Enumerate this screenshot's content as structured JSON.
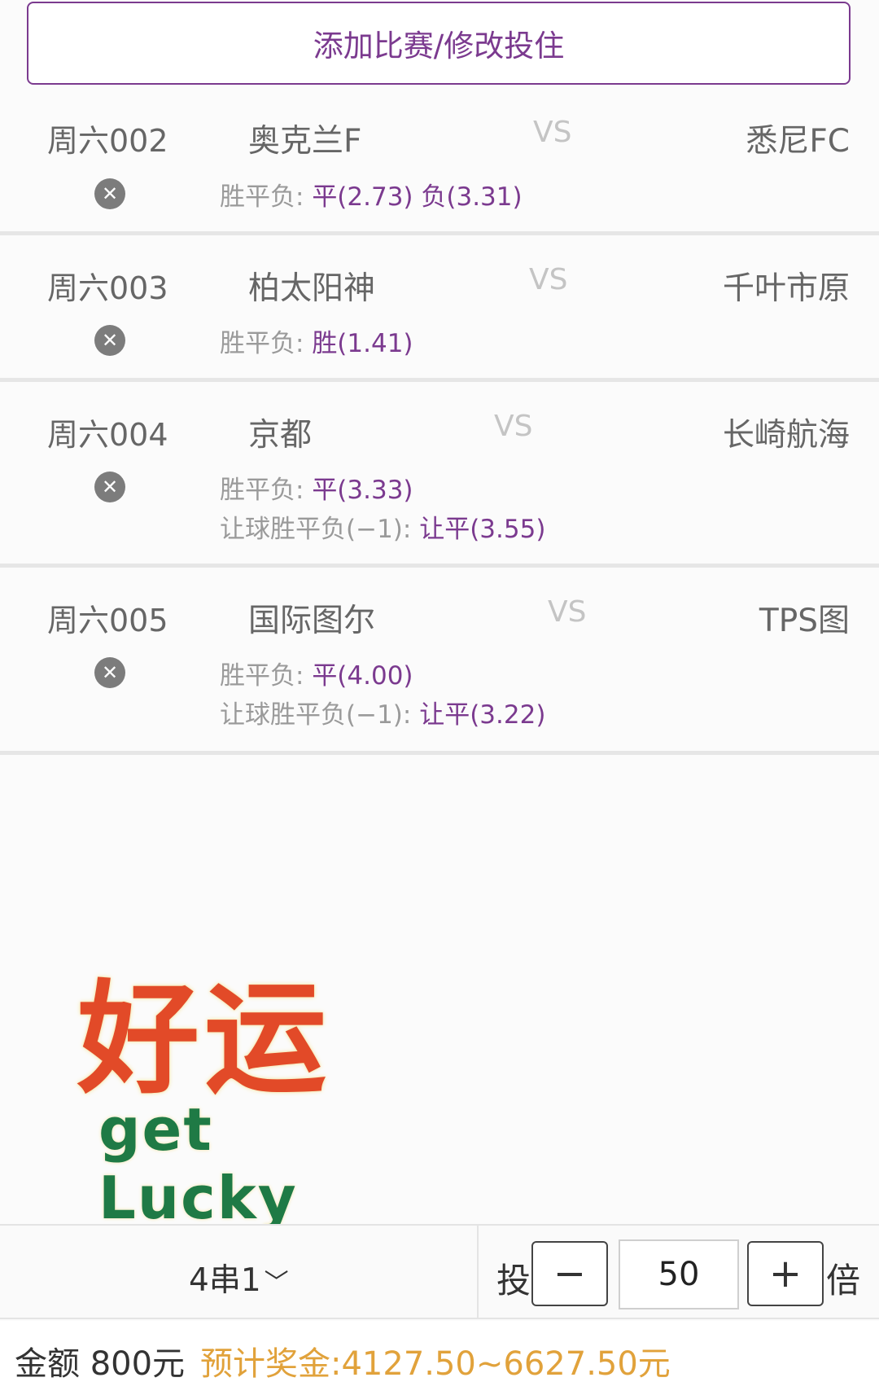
{
  "header": {
    "add_button_label": "添加比赛/修改投住"
  },
  "matches": [
    {
      "code": "周六002",
      "home": "奥克兰F",
      "vs": "VS",
      "away": "悉尼FC",
      "bets": [
        {
          "label": "胜平负:",
          "value": "平(2.73) 负(3.31)"
        }
      ]
    },
    {
      "code": "周六003",
      "home": "柏太阳神",
      "vs": "VS",
      "away": "千叶市原",
      "bets": [
        {
          "label": "胜平负:",
          "value": "胜(1.41)"
        }
      ]
    },
    {
      "code": "周六004",
      "home": "京都",
      "vs": "VS",
      "away": "长崎航海",
      "bets": [
        {
          "label": "胜平负:",
          "value": "平(3.33)"
        },
        {
          "label": "让球胜平负(−1):",
          "value": "让平(3.55)"
        }
      ]
    },
    {
      "code": "周六005",
      "home": "国际图尔",
      "vs": "VS",
      "away": "TPS图",
      "bets": [
        {
          "label": "胜平负:",
          "value": "平(4.00)"
        },
        {
          "label": "让球胜平负(−1):",
          "value": "让平(3.22)"
        }
      ]
    }
  ],
  "sticker": {
    "cn": "好运",
    "en": "get Lucky"
  },
  "bottom_bar": {
    "combo_label": "4串1",
    "combo_icon": "chevron-down-icon",
    "tou_label": "投",
    "minus_label": "−",
    "quantity": "50",
    "plus_label": "+",
    "bei_label": "倍"
  },
  "footer": {
    "amount_text": "金额 800元",
    "prize_text": "预计奖金:4127.50~6627.50元"
  },
  "colors": {
    "accent": "#7b3a8f",
    "prize": "#e1a23b",
    "sticker_red": "#e24a28",
    "sticker_green": "#1f7a45"
  }
}
